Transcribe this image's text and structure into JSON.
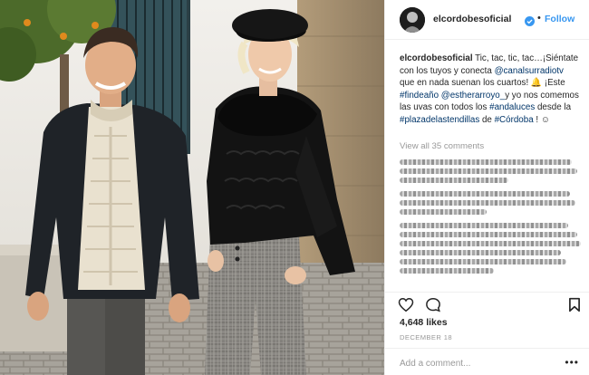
{
  "post": {
    "username": "elcordobesoficial",
    "separator": "•",
    "follow_label": "Follow"
  },
  "caption": {
    "username": "elcordobesoficial",
    "part1": "Tic, tac, tic, tac…¡Siéntate con los tuyos y conecta",
    "mention1": "@canalsurradiotv",
    "part2": "que en nada suenan los cuartos! 🔔 ¡Este",
    "hashtag1": "#findeaño",
    "mention2": "@estherarroyo_",
    "part3": "y yo nos comemos las uvas con todos los",
    "hashtag2": "#andaluces",
    "part4": "desde la",
    "hashtag3": "#plazadelastendillas",
    "part5": "de",
    "hashtag4": "#Córdoba",
    "part6": "! ☺"
  },
  "comments": {
    "view_all": "View all 35 comments"
  },
  "stats": {
    "likes": "4,648 likes",
    "date": "DECEMBER 18"
  },
  "composer": {
    "placeholder": "Add a comment...",
    "more": "•••"
  },
  "icons": {
    "like": "heart-icon",
    "comment": "comment-icon",
    "save": "bookmark-icon",
    "verified": "verified-badge-icon"
  },
  "colors": {
    "link": "#003569",
    "follow": "#3897f0",
    "verified": "#3897f0"
  }
}
